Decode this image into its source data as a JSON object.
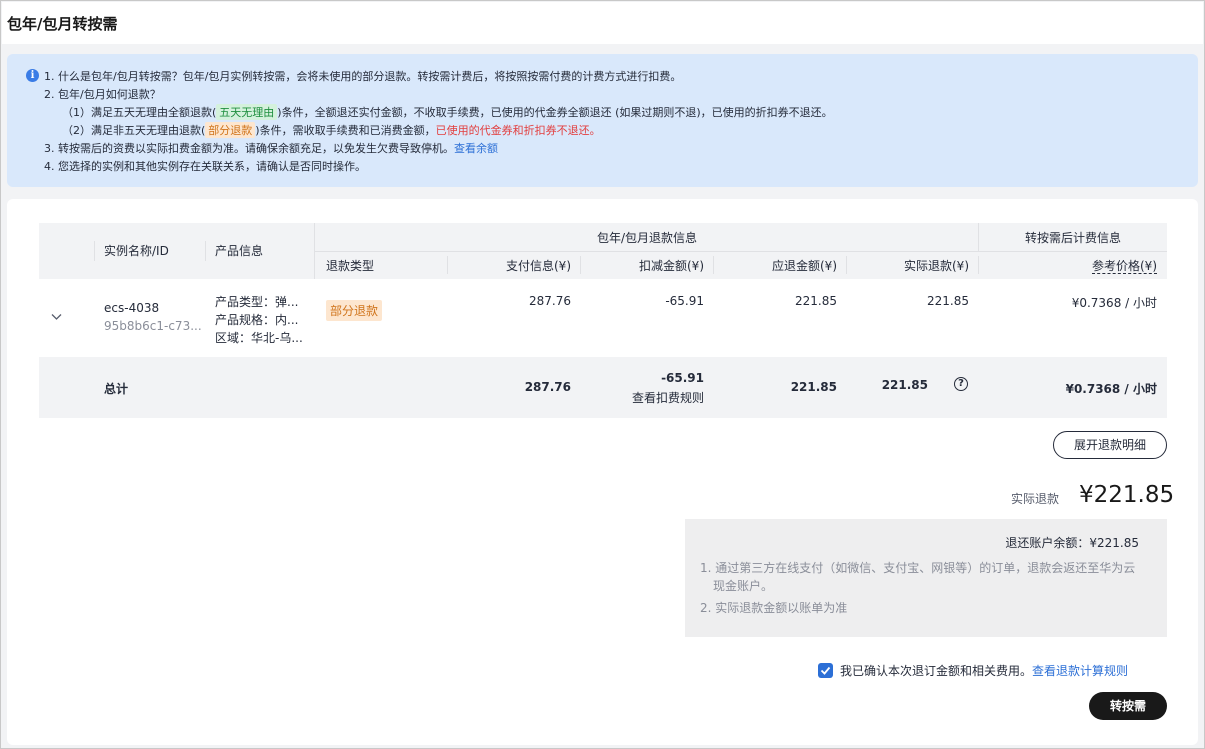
{
  "page": {
    "title": "包年/包月转按需"
  },
  "notice": {
    "line1": "1. 什么是包年/包月转按需？包年/包月实例转按需，会将未使用的部分退款。转按需计费后，将按照按需付费的计费方式进行扣费。",
    "line2": "2. 包年/包月如何退款？",
    "line3_prefix": "（1）满足五天无理由全额退款(",
    "line3_tag": "五天无理由",
    "line3_suffix": ")条件，全额退还实付金额，不收取手续费，已使用的代金券全额退还 (如果过期则不退)，已使用的折扣券不退还。",
    "line4_prefix": "（2）满足非五天无理由退款(",
    "line4_tag": "部分退款",
    "line4_mid": ")条件，需收取手续费和已消费金额，",
    "line4_red": "已使用的代金券和折扣券不退还。",
    "line5_text": "3. 转按需后的资费以实际扣费金额为准。请确保余额充足，以免发生欠费导致停机。",
    "line5_link": "查看余额",
    "line6": "4. 您选择的实例和其他实例存在关联关系，请确认是否同时操作。"
  },
  "table": {
    "headers": {
      "instance": "实例名称/ID",
      "product": "产品信息",
      "group_refund": "包年/包月退款信息",
      "group_after": "转按需后计费信息",
      "refund_type": "退款类型",
      "paid": "支付信息(¥)",
      "deduct": "扣减金额(¥)",
      "due": "应退金额(¥)",
      "actual": "实际退款(¥)",
      "ref_price": "参考价格(¥)"
    },
    "row": {
      "instance_name": "ecs-4038",
      "instance_id": "95b8b6c1-c73...",
      "product_type": "产品类型：弹...",
      "product_spec": "产品规格：内...",
      "region": "区域：华北-乌...",
      "refund_type": "部分退款",
      "paid": "287.76",
      "deduct": "-65.91",
      "due": "221.85",
      "actual": "221.85",
      "ref_price": "¥0.7368 / 小时"
    },
    "total": {
      "label": "总计",
      "paid": "287.76",
      "deduct": "-65.91",
      "deduct_link": "查看扣费规则",
      "due": "221.85",
      "actual": "221.85",
      "ref_price": "¥0.7368 / 小时"
    }
  },
  "actions": {
    "expand_details": "展开退款明细",
    "refund_label": "实际退款",
    "refund_amount": "¥221.85",
    "balance_title": "退还账户余额：¥221.85",
    "note1_line1": "1. 通过第三方在线支付（如微信、支付宝、网银等）的订单，退款会返还至华为云",
    "note1_line2": "现金账户。",
    "note2": "2. 实际退款金额以账单为准",
    "confirm_text": "我已确认本次退订金额和相关费用。",
    "confirm_link": "查看退款计算规则",
    "confirm_checked": true,
    "submit": "转按需"
  },
  "colors": {
    "accent": "#2c6fd6",
    "notice_bg": "#d9e8fb",
    "primary_button": "#191919",
    "warning_red": "#e23d3d"
  }
}
